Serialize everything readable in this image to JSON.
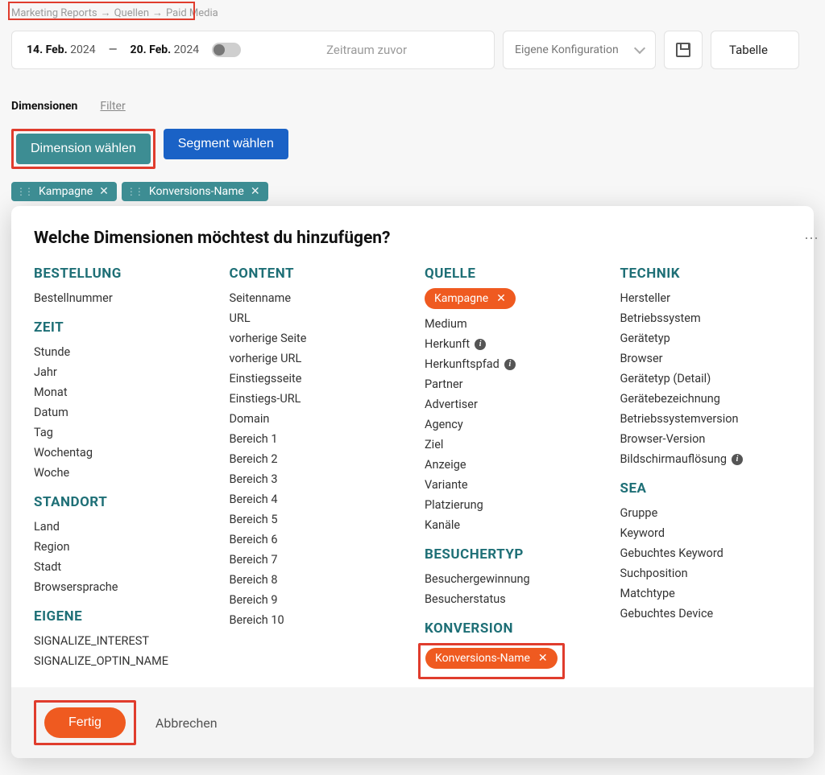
{
  "breadcrumb": {
    "a": "Marketing Reports",
    "b": "Quellen",
    "c": "Paid Media"
  },
  "topbar": {
    "date_from_day": "14. Feb.",
    "date_from_year": "2024",
    "dash": "—",
    "date_to_day": "20. Feb.",
    "date_to_year": "2024",
    "prev_label": "Zeitraum zuvor",
    "config_label": "Eigene Konfiguration",
    "table_label": "Tabelle"
  },
  "tabs": {
    "dimensions": "Dimensionen",
    "filter": "Filter"
  },
  "selectors": {
    "dimension": "Dimension wählen",
    "segment": "Segment wählen"
  },
  "chips": [
    {
      "label": "Kampagne"
    },
    {
      "label": "Konversions-Name"
    }
  ],
  "modal": {
    "title": "Welche Dimensionen möchtest du hinzufügen?",
    "footer": {
      "done": "Fertig",
      "cancel": "Abbrechen"
    },
    "col1": {
      "bestellung": {
        "head": "BESTELLUNG",
        "items": [
          "Bestellnummer"
        ]
      },
      "zeit": {
        "head": "ZEIT",
        "items": [
          "Stunde",
          "Jahr",
          "Monat",
          "Datum",
          "Tag",
          "Wochentag",
          "Woche"
        ]
      },
      "standort": {
        "head": "STANDORT",
        "items": [
          "Land",
          "Region",
          "Stadt",
          "Browsersprache"
        ]
      },
      "eigene": {
        "head": "EIGENE",
        "items": [
          "SIGNALIZE_INTEREST",
          "SIGNALIZE_OPTIN_NAME"
        ]
      }
    },
    "col2": {
      "content": {
        "head": "CONTENT",
        "items": [
          "Seitenname",
          "URL",
          "vorherige Seite",
          "vorherige URL",
          "Einstiegsseite",
          "Einstiegs-URL",
          "Domain",
          "Bereich 1",
          "Bereich 2",
          "Bereich 3",
          "Bereich 4",
          "Bereich 5",
          "Bereich 6",
          "Bereich 7",
          "Bereich 8",
          "Bereich 9",
          "Bereich 10"
        ]
      }
    },
    "col3": {
      "quelle": {
        "head": "QUELLE",
        "selected": "Kampagne",
        "items": [
          "Medium",
          "Herkunft",
          "Herkunftspfad",
          "Partner",
          "Advertiser",
          "Agency",
          "Ziel",
          "Anzeige",
          "Variante",
          "Platzierung",
          "Kanäle"
        ],
        "info_idx": [
          1,
          2
        ]
      },
      "besuchertyp": {
        "head": "BESUCHERTYP",
        "items": [
          "Besuchergewinnung",
          "Besucherstatus"
        ]
      },
      "konversion": {
        "head": "KONVERSION",
        "selected": "Konversions-Name"
      }
    },
    "col4": {
      "technik": {
        "head": "TECHNIK",
        "items": [
          "Hersteller",
          "Betriebssystem",
          "Gerätetyp",
          "Browser",
          "Gerätetyp (Detail)",
          "Gerätebezeichnung",
          "Betriebssystemversion",
          "Browser-Version",
          "Bildschirmauflösung"
        ],
        "info_idx": [
          8
        ]
      },
      "sea": {
        "head": "SEA",
        "items": [
          "Gruppe",
          "Keyword",
          "Gebuchtes Keyword",
          "Suchposition",
          "Matchtype",
          "Gebuchtes Device"
        ]
      }
    }
  }
}
